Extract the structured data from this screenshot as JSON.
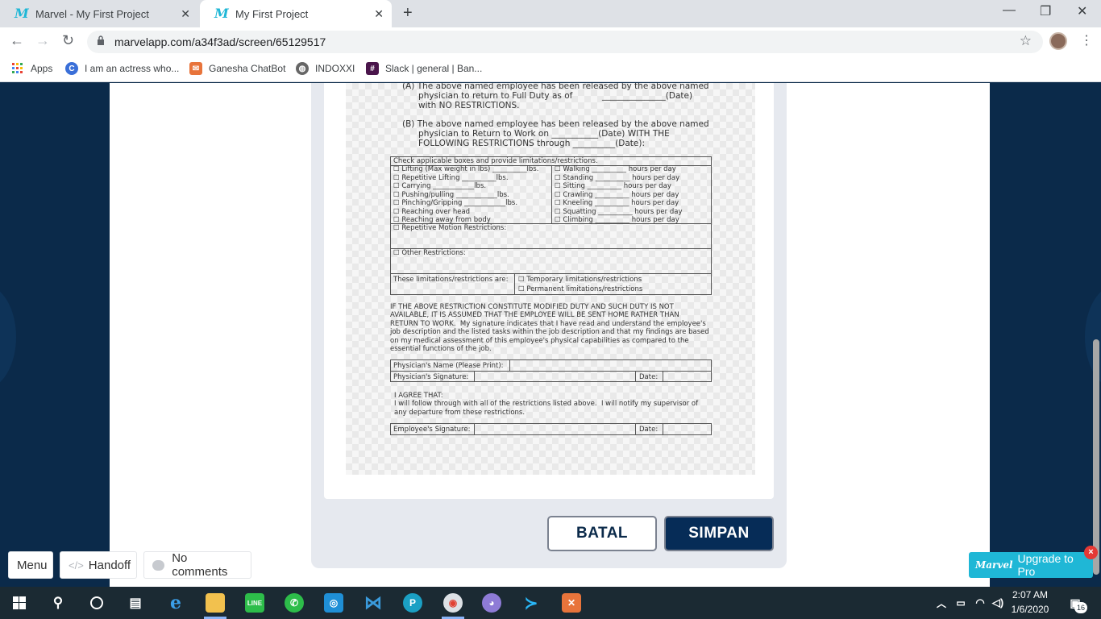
{
  "browser": {
    "tabs": [
      {
        "title": "Marvel - My First Project",
        "active": false
      },
      {
        "title": "My First Project",
        "active": true
      }
    ],
    "url": "marvelapp.com/a34f3ad/screen/65129517",
    "bookmarks": [
      {
        "label": "Apps",
        "icon": "apps-grid-icon"
      },
      {
        "label": "I am an actress who...",
        "icon": "c-icon"
      },
      {
        "label": "Ganesha ChatBot",
        "icon": "chatbot-icon"
      },
      {
        "label": "INDOXXI",
        "icon": "globe-icon"
      },
      {
        "label": "Slack | general | Ban...",
        "icon": "slack-icon"
      }
    ]
  },
  "document": {
    "optionA": "(A) The above named employee has been released by the above named\n      physician to return to Full Duty as of           _______________(Date)\n      with NO RESTRICTIONS.",
    "optionB": "(B) The above named employee has been released by the above named\n      physician to Return to Work on ___________(Date) WITH THE\n      FOLLOWING RESTRICTIONS through __________(Date):",
    "restrictions_header": "Check applicable boxes and provide limitations/restrictions.",
    "left_items": [
      "☐ Lifting (Max weight in lbs) __________lbs.",
      "☐ Repetitive Lifting __________lbs.",
      "☐ Carrying ____________lbs.",
      "☐ Pushing/pulling ____________lbs.",
      "☐ Pinching/Gripping ____________lbs.",
      "☐ Reaching over head",
      "☐ Reaching away from body"
    ],
    "right_items": [
      "☐ Walking __________ hours per day",
      "☐ Standing __________ hours per day",
      "☐ Sitting __________ hours per day",
      "☐ Crawling __________ hours per day",
      "☐ Kneeling __________ hours per day",
      "☐ Squatting __________ hours per day",
      "☐ Climbing __________ hours per day"
    ],
    "repetitive_motion": "☐ Repetitive Motion Restrictions:",
    "other_restrictions": "☐ Other Restrictions:",
    "limitations_label": "These limitations/restrictions are:",
    "temporary": "☐ Temporary limitations/restrictions",
    "permanent": "☐ Permanent limitations/restrictions",
    "notice": "IF THE ABOVE RESTRICTION CONSTITUTE MODIFIED DUTY AND SUCH DUTY IS NOT\nAVAILABLE, IT IS ASSUMED THAT THE EMPLOYEE WILL BE SENT HOME RATHER THAN\nRETURN TO WORK.  My signature indicates that I have read and understand the employee's\njob description and the listed tasks within the job description and that my findings are based\non my medical assessment of this employee's physical capabilities as compared to the\nessential functions of the job.",
    "physician_name": "Physician's Name (Please Print):",
    "physician_signature": "Physician's Signature:",
    "date_label": "Date:",
    "agree": "I AGREE THAT:\nI will follow through with all of the restrictions listed above.  I will notify my supervisor of\nany departure from these restrictions.",
    "employee_signature": "Employee's Signature:"
  },
  "actions": {
    "batal": "BATAL",
    "simpan": "SIMPAN"
  },
  "marvel_bar": {
    "menu": "Menu",
    "handoff": "Handoff",
    "comments": "No comments",
    "upgrade": "Upgrade to Pro",
    "upgrade_logo": "Marvel"
  },
  "taskbar": {
    "time": "2:07 AM",
    "date": "1/6/2020",
    "notifications": "16"
  }
}
